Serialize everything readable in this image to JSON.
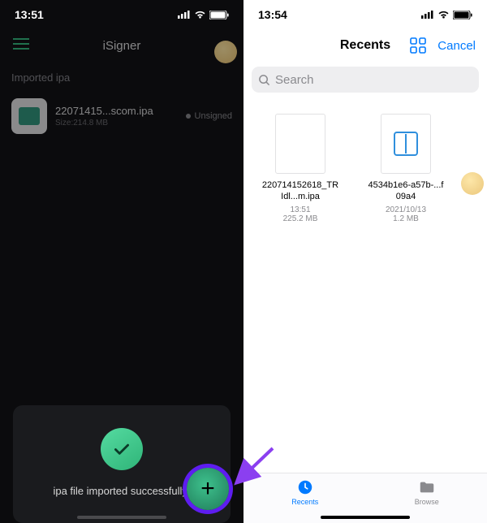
{
  "left": {
    "status_time": "13:51",
    "title": "iSigner",
    "section_label": "Imported ipa",
    "ipa_name": "22071415...scom.ipa",
    "ipa_size": "Size:214.8 MB",
    "ipa_status": "Unsigned",
    "success_msg": "ipa file imported successfully!"
  },
  "right": {
    "status_time": "13:54",
    "title": "Recents",
    "cancel": "Cancel",
    "search_placeholder": "Search",
    "files": [
      {
        "name": "220714152618_TRIdl...m.ipa",
        "time": "13:51",
        "size": "225.2 MB"
      },
      {
        "name": "4534b1e6-a57b-...f09a4",
        "time": "2021/10/13",
        "size": "1.2 MB"
      }
    ],
    "tabs": {
      "recents": "Recents",
      "browse": "Browse"
    }
  }
}
